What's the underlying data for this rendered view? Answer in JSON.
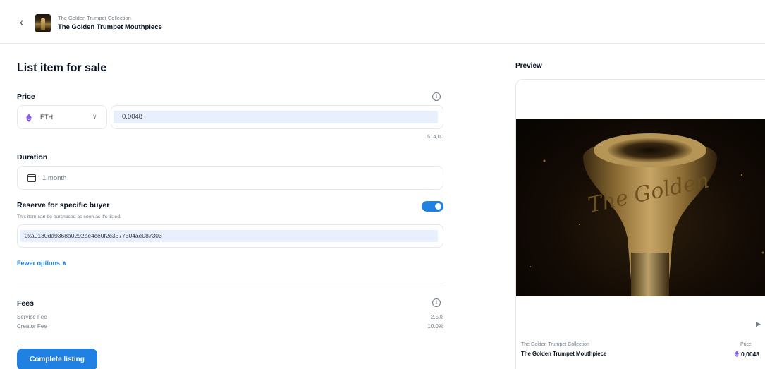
{
  "header": {
    "back_icon": "chevron-left-icon",
    "collection_name": "The Golden Trumpet Collection",
    "item_name": "The Golden Trumpet Mouthpiece"
  },
  "form": {
    "title": "List item for sale",
    "price": {
      "label": "Price",
      "currency": "ETH",
      "value": "0.0048",
      "usd_value": "$14,00"
    },
    "duration": {
      "label": "Duration",
      "value": "1 month"
    },
    "reserve": {
      "label": "Reserve for specific buyer",
      "description": "This item can be purchased as soon as it's listed.",
      "enabled": true,
      "address": "0xa0130da9368a0292be4ce0f2c3577504ae087303"
    },
    "fewer_options": "Fewer options",
    "fees": {
      "label": "Fees",
      "rows": [
        {
          "name": "Service Fee",
          "value": "2.5%"
        },
        {
          "name": "Creator Fee",
          "value": "10.0%"
        }
      ]
    },
    "submit_label": "Complete listing"
  },
  "preview": {
    "label": "Preview",
    "collection_name": "The Golden Trumpet Collection",
    "item_name": "The Golden Trumpet Mouthpiece",
    "price_label": "Price",
    "price_value": "0,0048",
    "engraving": "The Golden"
  },
  "colors": {
    "accent": "#2081e2",
    "eth": "#8a5cf6",
    "text": "#04111d",
    "muted": "#707a83",
    "border": "#e5e8eb"
  }
}
